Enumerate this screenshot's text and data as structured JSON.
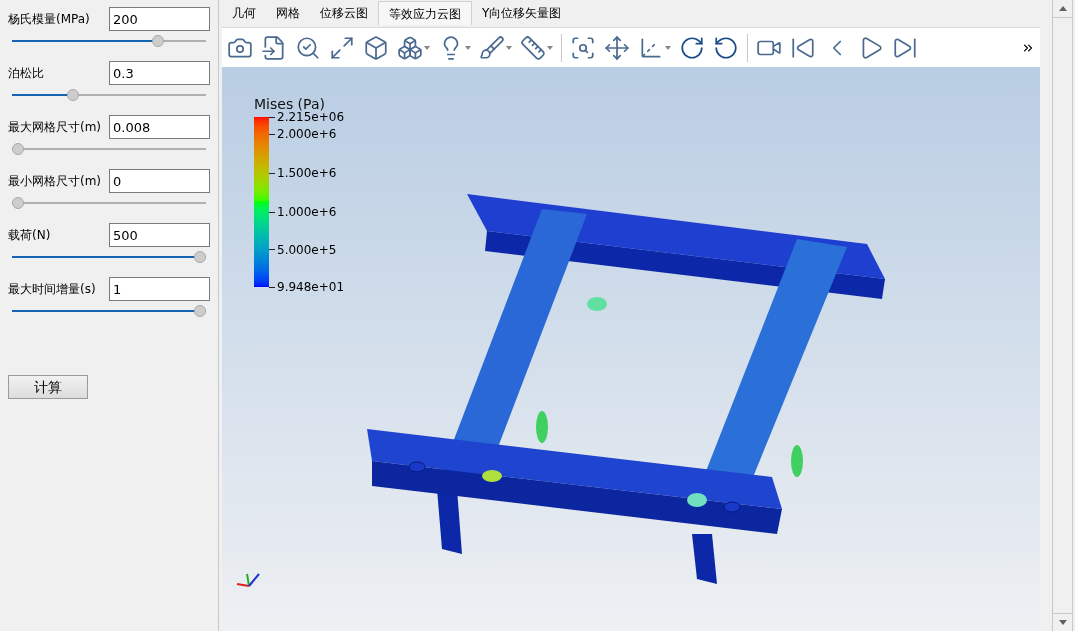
{
  "parameters": [
    {
      "label": "杨氏模量(MPa)",
      "value": "200",
      "level": 0.77
    },
    {
      "label": "泊松比",
      "value": "0.3",
      "level": 0.3
    },
    {
      "label": "最大网格尺寸(m)",
      "value": "0.008",
      "level": 0
    },
    {
      "label": "最小网格尺寸(m)",
      "value": "0",
      "level": 0
    },
    {
      "label": "载荷(N)",
      "value": "500",
      "level": 1
    },
    {
      "label": "最大时间增量(s)",
      "value": "1",
      "level": 1
    }
  ],
  "compute_button": "计算",
  "tabs": [
    {
      "label": "几何",
      "selected": false
    },
    {
      "label": "网格",
      "selected": false
    },
    {
      "label": "位移云图",
      "selected": false
    },
    {
      "label": "等效应力云图",
      "selected": true
    },
    {
      "label": "Y向位移矢量图",
      "selected": false
    }
  ],
  "legend": {
    "title": "Mises (Pa)",
    "ticks": [
      "2.215e+06",
      "2.000e+6",
      "1.500e+6",
      "1.000e+6",
      "5.000e+5",
      "9.948e+01"
    ]
  }
}
